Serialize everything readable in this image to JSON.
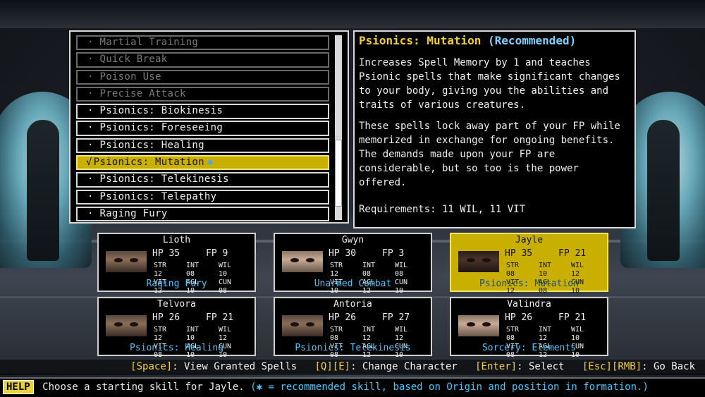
{
  "skills": [
    {
      "label": "Martial Training",
      "state": "disabled"
    },
    {
      "label": "Quick Break",
      "state": "disabled"
    },
    {
      "label": "Poison Use",
      "state": "disabled"
    },
    {
      "label": "Precise Attack",
      "state": "disabled"
    },
    {
      "label": "Psionics: Biokinesis",
      "state": "normal"
    },
    {
      "label": "Psionics: Foreseeing",
      "state": "normal"
    },
    {
      "label": "Psionics: Healing",
      "state": "normal"
    },
    {
      "label": "Psionics: Mutation",
      "state": "selected",
      "check": "√",
      "rec_mark": "✱"
    },
    {
      "label": "Psionics: Telekinesis",
      "state": "normal"
    },
    {
      "label": "Psionics: Telepathy",
      "state": "normal"
    },
    {
      "label": "Raging Fury",
      "state": "normal"
    }
  ],
  "bullet": "·",
  "description": {
    "title": "Psionics: Mutation",
    "title_tag": "(Recommended)",
    "para1": "Increases Spell Memory by 1 and teaches\nPsionic spells that make significant changes\nto your body, giving you the abilities and\ntraits of various creatures.",
    "para2": "These spells lock away part of your FP while\nmemorized in exchange for ongoing benefits.\nThe demands made upon your FP are\nconsiderable, but so too is the power offered.",
    "requirements": "Requirements: 11 WIL, 11 VIT"
  },
  "characters": [
    {
      "name": "Lioth",
      "hp": "35",
      "fp": "9",
      "str": "12",
      "int": "08",
      "wil": "10",
      "vit": "12",
      "agl": "10",
      "cun": "08",
      "skill": "Raging Fury",
      "selected": false
    },
    {
      "name": "Gwyn",
      "hp": "30",
      "fp": "3",
      "str": "12",
      "int": "08",
      "wil": "08",
      "vit": "10",
      "agl": "12",
      "cun": "10",
      "skill": "Unarmed Combat",
      "selected": false
    },
    {
      "name": "Jayle",
      "hp": "35",
      "fp": "21",
      "str": "08",
      "int": "10",
      "wil": "12",
      "vit": "12",
      "agl": "08",
      "cun": "10",
      "skill": "Psionics: Mutation",
      "selected": true
    },
    {
      "name": "Telvora",
      "hp": "26",
      "fp": "21",
      "str": "12",
      "int": "10",
      "wil": "12",
      "vit": "08",
      "agl": "10",
      "cun": "10",
      "skill": "Psionics: Healing",
      "selected": false
    },
    {
      "name": "Antoria",
      "hp": "26",
      "fp": "27",
      "str": "08",
      "int": "12",
      "wil": "12",
      "vit": "08",
      "agl": "12",
      "cun": "10",
      "skill": "Psionics: Telekinesis",
      "selected": false
    },
    {
      "name": "Valindra",
      "hp": "26",
      "fp": "21",
      "str": "08",
      "int": "12",
      "wil": "10",
      "vit": "08",
      "agl": "12",
      "cun": "10",
      "skill": "Sorcery: Elements",
      "selected": false
    }
  ],
  "labels": {
    "hp": "HP",
    "fp": "FP",
    "str": "STR",
    "int": "INT",
    "wil": "WIL",
    "vit": "VIT",
    "agl": "AGL",
    "cun": "CUN"
  },
  "hints": [
    {
      "key": "[Space]",
      "text": ": View Granted Spells"
    },
    {
      "key": "[Q][E]",
      "text": ": Change Character"
    },
    {
      "key": "[Enter]",
      "text": ": Select"
    },
    {
      "key": "[Esc][RMB]",
      "text": ": Go Back"
    }
  ],
  "help": {
    "tag": "HELP",
    "text": "Choose a starting skill for Jayle.",
    "note": "(✱ = recommended skill, based on Origin and position in formation.)"
  }
}
